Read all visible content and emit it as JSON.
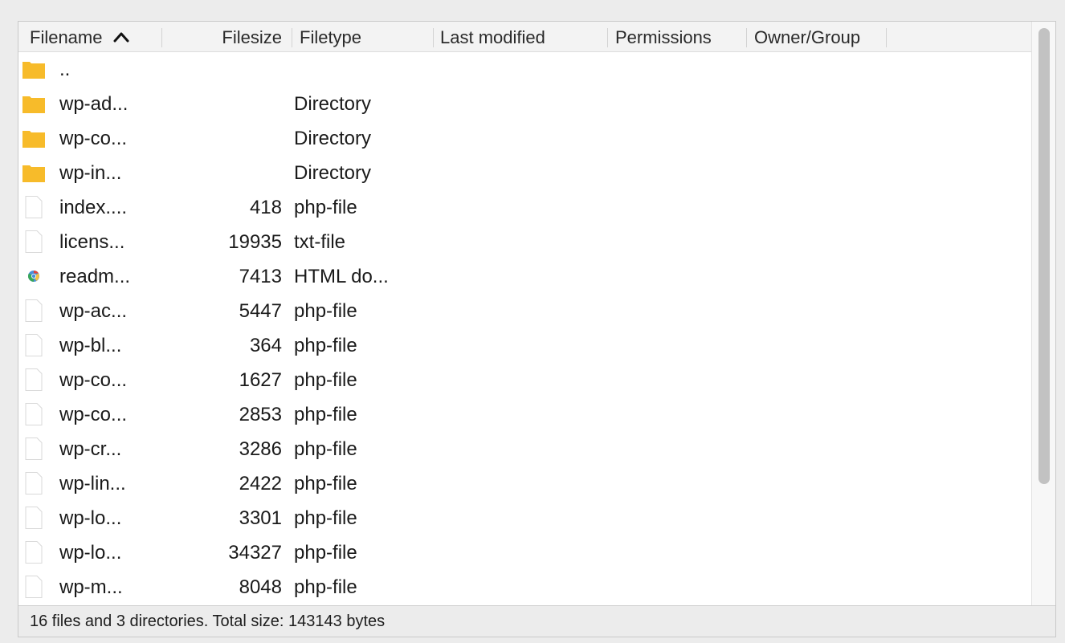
{
  "columns": {
    "filename": "Filename",
    "filesize": "Filesize",
    "filetype": "Filetype",
    "last_modified": "Last modified",
    "permissions": "Permissions",
    "owner_group": "Owner/Group",
    "sort_icon": "chevron-up-icon"
  },
  "rows": [
    {
      "icon": "folder-icon",
      "name": "..",
      "size": "",
      "type": ""
    },
    {
      "icon": "folder-icon",
      "name": "wp-ad...",
      "size": "",
      "type": "Directory"
    },
    {
      "icon": "folder-icon",
      "name": "wp-co...",
      "size": "",
      "type": "Directory"
    },
    {
      "icon": "folder-icon",
      "name": "wp-in...",
      "size": "",
      "type": "Directory"
    },
    {
      "icon": "file-icon",
      "name": "index....",
      "size": "418",
      "type": "php-file"
    },
    {
      "icon": "file-icon",
      "name": "licens...",
      "size": "19935",
      "type": "txt-file"
    },
    {
      "icon": "browser-icon",
      "name": "readm...",
      "size": "7413",
      "type": "HTML do..."
    },
    {
      "icon": "file-icon",
      "name": "wp-ac...",
      "size": "5447",
      "type": "php-file"
    },
    {
      "icon": "file-icon",
      "name": "wp-bl...",
      "size": "364",
      "type": "php-file"
    },
    {
      "icon": "file-icon",
      "name": "wp-co...",
      "size": "1627",
      "type": "php-file"
    },
    {
      "icon": "file-icon",
      "name": "wp-co...",
      "size": "2853",
      "type": "php-file"
    },
    {
      "icon": "file-icon",
      "name": "wp-cr...",
      "size": "3286",
      "type": "php-file"
    },
    {
      "icon": "file-icon",
      "name": "wp-lin...",
      "size": "2422",
      "type": "php-file"
    },
    {
      "icon": "file-icon",
      "name": "wp-lo...",
      "size": "3301",
      "type": "php-file"
    },
    {
      "icon": "file-icon",
      "name": "wp-lo...",
      "size": "34327",
      "type": "php-file"
    },
    {
      "icon": "file-icon",
      "name": "wp-m...",
      "size": "8048",
      "type": "php-file"
    }
  ],
  "status": {
    "text": "16 files and 3 directories. Total size: 143143 bytes"
  },
  "colors": {
    "folder": "#f7bb2a",
    "header_bg": "#f3f3f3",
    "status_bg": "#ececec"
  }
}
